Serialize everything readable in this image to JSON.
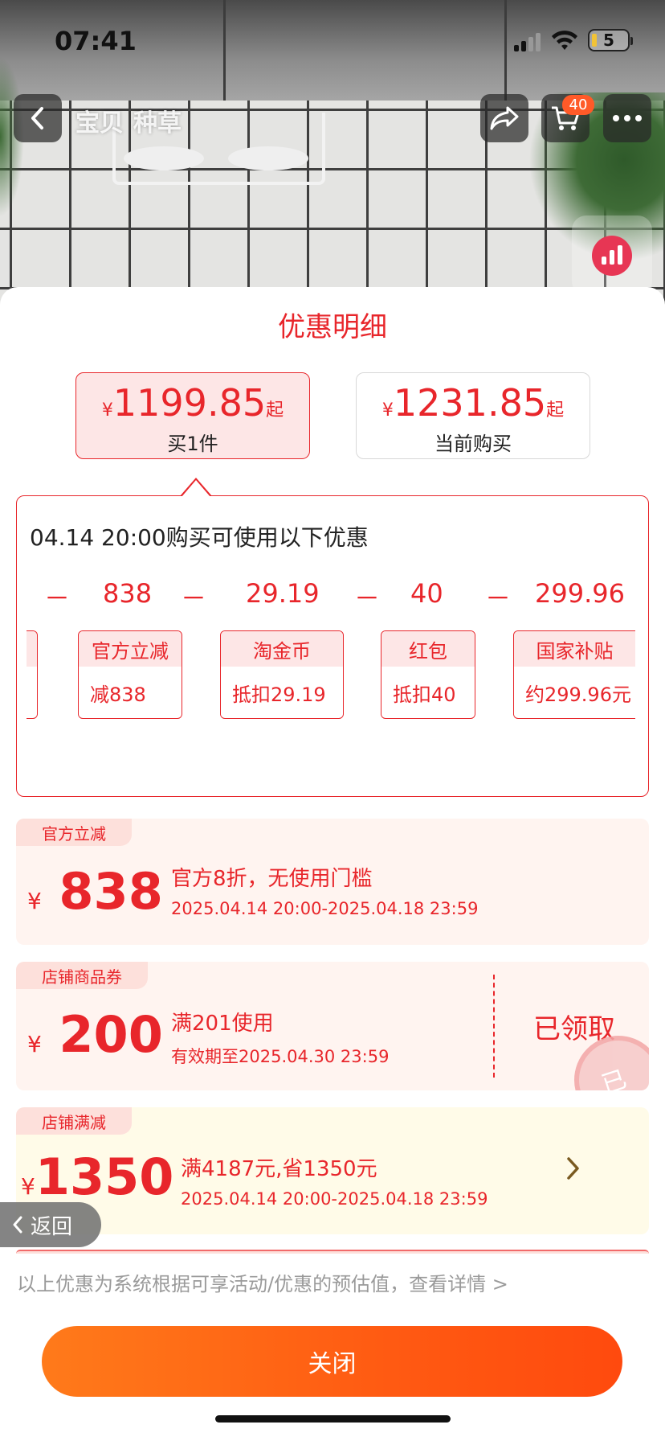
{
  "status_bar": {
    "time": "07:41",
    "battery": "5"
  },
  "nav": {
    "tabs": [
      "宝贝",
      "种草"
    ],
    "cart_count": "40"
  },
  "sheet": {
    "title": "优惠明细",
    "price_options": [
      {
        "currency": "¥",
        "amount": "1199.85",
        "suffix": "起",
        "label": "买1件",
        "selected": true
      },
      {
        "currency": "¥",
        "amount": "1231.85",
        "suffix": "起",
        "label": "当前购买",
        "selected": false
      }
    ],
    "detail": {
      "headline": "04.14 20:00购买可使用以下优惠",
      "minus_sign": "－",
      "items": [
        {
          "amount": "838",
          "name": "官方立减",
          "value": "减838"
        },
        {
          "amount": "29.19",
          "name": "淘金币",
          "value": "抵扣29.19"
        },
        {
          "amount": "40",
          "name": "红包",
          "value": "抵扣40"
        },
        {
          "amount": "299.96",
          "name": "国家补贴",
          "value": "约299.96元"
        }
      ]
    },
    "coupons": [
      {
        "tag": "官方立减",
        "currency": "¥",
        "amount": "838",
        "title": "官方8折，无使用门槛",
        "period": "2025.04.14 20:00-2025.04.18 23:59"
      },
      {
        "tag": "店铺商品券",
        "currency": "¥",
        "amount": "200",
        "title": "满201使用",
        "period": "有效期至2025.04.30 23:59",
        "status": "已领取",
        "stamp": "已领"
      },
      {
        "tag": "店铺满减",
        "currency": "¥",
        "amount": "1350",
        "title": "满4187元,省1350元",
        "period": "2025.04.14 20:00-2025.04.18 23:59"
      }
    ],
    "back_label": "返回",
    "footnote": "以上优惠为系统根据可享活动/优惠的预估值，查看详情 >",
    "close_label": "关闭"
  },
  "colors": {
    "accent": "#e8262b",
    "button_start": "#ff7a1a",
    "button_end": "#ff4a0e"
  }
}
